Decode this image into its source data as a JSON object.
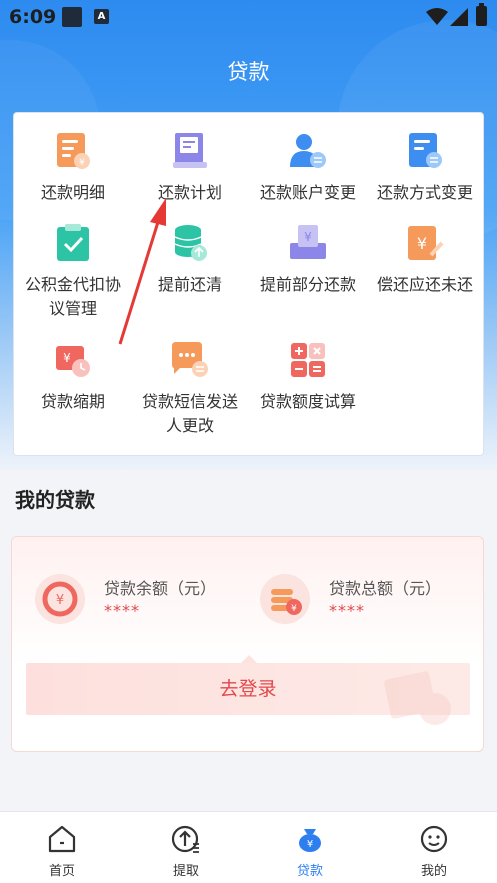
{
  "status_bar": {
    "time": "6:09",
    "notif_badge": "A"
  },
  "header": {
    "title": "贷款"
  },
  "menu": {
    "items": [
      {
        "label": "还款明细",
        "icon": "repayment-detail-icon"
      },
      {
        "label": "还款计划",
        "icon": "repayment-plan-icon"
      },
      {
        "label": "还款账户变更",
        "icon": "account-change-icon"
      },
      {
        "label": "还款方式变更",
        "icon": "method-change-icon"
      },
      {
        "label": "公积金代扣协",
        "label2": "议管理",
        "icon": "agreement-icon"
      },
      {
        "label": "提前还清",
        "icon": "prepay-all-icon"
      },
      {
        "label": "提前部分还款",
        "icon": "prepay-partial-icon"
      },
      {
        "label": "偿还应还未还",
        "icon": "repay-overdue-icon"
      },
      {
        "label": "贷款缩期",
        "icon": "shorten-term-icon"
      },
      {
        "label": "贷款短信发送",
        "label2": "人更改",
        "icon": "sms-change-icon"
      },
      {
        "label": "贷款额度试算",
        "icon": "calculator-icon"
      }
    ]
  },
  "my_loans": {
    "title": "我的贷款",
    "balance_label": "贷款余额（元）",
    "balance_value": "****",
    "total_label": "贷款总额（元）",
    "total_value": "****",
    "login_button": "去登录"
  },
  "tabbar": {
    "items": [
      {
        "label": "首页",
        "icon": "home-icon"
      },
      {
        "label": "提取",
        "icon": "withdraw-icon"
      },
      {
        "label": "贷款",
        "icon": "loan-icon"
      },
      {
        "label": "我的",
        "icon": "profile-icon"
      }
    ],
    "active": "贷款"
  },
  "colors": {
    "primary": "#2d8bf0",
    "accent_red": "#e2484c",
    "active_tab": "#2d7ff0"
  }
}
